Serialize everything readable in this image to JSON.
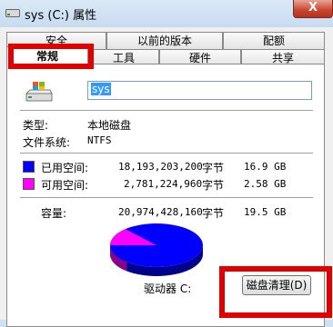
{
  "window": {
    "title": "sys (C:) 属性",
    "close_label": "X"
  },
  "tabs_row1": [
    "安全",
    "以前的版本",
    "配额"
  ],
  "tabs_row2": [
    "常规",
    "工具",
    "硬件",
    "共享"
  ],
  "active_tab": "常规",
  "drive": {
    "name": "sys",
    "type_label": "类型:",
    "type_value": "本地磁盘",
    "fs_label": "文件系统:",
    "fs_value": "NTFS"
  },
  "space": {
    "used_label": "已用空间:",
    "used_bytes": "18,193,203,200",
    "used_unit": "字节",
    "used_size": "16.9 GB",
    "free_label": "可用空间:",
    "free_bytes": "2,781,224,960",
    "free_unit": "字节",
    "free_size": "2.58 GB",
    "capacity_label": "容量:",
    "capacity_bytes": "20,974,428,160",
    "capacity_unit": "字节",
    "capacity_size": "19.5 GB",
    "used_fraction": 0.867
  },
  "drive_label": "驱动器 C:",
  "clean_button": "磁盘清理(D)",
  "colors": {
    "used": "#0000ff",
    "free": "#ff00ff",
    "highlight": "#e00000"
  }
}
